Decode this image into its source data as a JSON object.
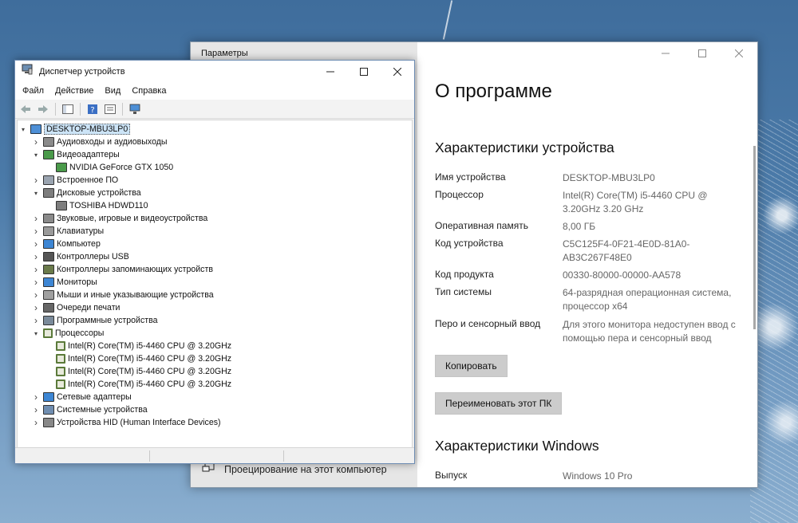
{
  "settings": {
    "window_title": "Параметры",
    "heading": "О программе",
    "device_specs_heading": "Характеристики устройства",
    "specs": [
      {
        "label": "Имя устройства",
        "value": "DESKTOP-MBU3LP0"
      },
      {
        "label": "Процессор",
        "value": "Intel(R) Core(TM) i5-4460  CPU @ 3.20GHz   3.20 GHz"
      },
      {
        "label": "Оперативная память",
        "value": "8,00 ГБ"
      },
      {
        "label": "Код устройства",
        "value": "C5C125F4-0F21-4E0D-81A0-AB3C267F48E0"
      },
      {
        "label": "Код продукта",
        "value": "00330-80000-00000-AA578"
      },
      {
        "label": "Тип системы",
        "value": "64-разрядная операционная система, процессор x64"
      },
      {
        "label": "Перо и сенсорный ввод",
        "value": "Для этого монитора недоступен ввод с помощью пера и сенсорный ввод"
      }
    ],
    "copy_button": "Копировать",
    "rename_button": "Переименовать этот ПК",
    "windows_specs_heading": "Характеристики Windows",
    "edition_label": "Выпуск",
    "edition_value": "Windows 10 Pro",
    "project_label": "Проецирование на этот компьютер"
  },
  "device_manager": {
    "window_title": "Диспетчер устройств",
    "menu": [
      "Файл",
      "Действие",
      "Вид",
      "Справка"
    ],
    "root": "DESKTOP-MBU3LP0",
    "tree": [
      {
        "label": "Аудиовходы и аудиовыходы",
        "level": 1,
        "expand": "collapsed",
        "icon": "speaker-icon"
      },
      {
        "label": "Видеоадаптеры",
        "level": 1,
        "expand": "expanded",
        "icon": "display-adapter-icon"
      },
      {
        "label": "NVIDIA GeForce GTX 1050",
        "level": 2,
        "expand": "none",
        "icon": "display-adapter-icon"
      },
      {
        "label": "Встроенное ПО",
        "level": 1,
        "expand": "collapsed",
        "icon": "firmware-icon"
      },
      {
        "label": "Дисковые устройства",
        "level": 1,
        "expand": "expanded",
        "icon": "disk-icon"
      },
      {
        "label": "TOSHIBA HDWD110",
        "level": 2,
        "expand": "none",
        "icon": "disk-icon"
      },
      {
        "label": "Звуковые, игровые и видеоустройства",
        "level": 1,
        "expand": "collapsed",
        "icon": "speaker-icon"
      },
      {
        "label": "Клавиатуры",
        "level": 1,
        "expand": "collapsed",
        "icon": "keyboard-icon"
      },
      {
        "label": "Компьютер",
        "level": 1,
        "expand": "collapsed",
        "icon": "monitor-icon"
      },
      {
        "label": "Контроллеры USB",
        "level": 1,
        "expand": "collapsed",
        "icon": "usb-icon"
      },
      {
        "label": "Контроллеры запоминающих устройств",
        "level": 1,
        "expand": "collapsed",
        "icon": "storage-controller-icon"
      },
      {
        "label": "Мониторы",
        "level": 1,
        "expand": "collapsed",
        "icon": "monitor-icon"
      },
      {
        "label": "Мыши и иные указывающие устройства",
        "level": 1,
        "expand": "collapsed",
        "icon": "mouse-icon"
      },
      {
        "label": "Очереди печати",
        "level": 1,
        "expand": "collapsed",
        "icon": "printer-icon"
      },
      {
        "label": "Программные устройства",
        "level": 1,
        "expand": "collapsed",
        "icon": "software-device-icon"
      },
      {
        "label": "Процессоры",
        "level": 1,
        "expand": "expanded",
        "icon": "processor-icon"
      },
      {
        "label": "Intel(R) Core(TM) i5-4460  CPU @ 3.20GHz",
        "level": 2,
        "expand": "none",
        "icon": "processor-icon"
      },
      {
        "label": "Intel(R) Core(TM) i5-4460  CPU @ 3.20GHz",
        "level": 2,
        "expand": "none",
        "icon": "processor-icon"
      },
      {
        "label": "Intel(R) Core(TM) i5-4460  CPU @ 3.20GHz",
        "level": 2,
        "expand": "none",
        "icon": "processor-icon"
      },
      {
        "label": "Intel(R) Core(TM) i5-4460  CPU @ 3.20GHz",
        "level": 2,
        "expand": "none",
        "icon": "processor-icon"
      },
      {
        "label": "Сетевые адаптеры",
        "level": 1,
        "expand": "collapsed",
        "icon": "network-icon"
      },
      {
        "label": "Системные устройства",
        "level": 1,
        "expand": "collapsed",
        "icon": "system-device-icon"
      },
      {
        "label": "Устройства HID (Human Interface Devices)",
        "level": 1,
        "expand": "collapsed",
        "icon": "hid-icon"
      }
    ]
  },
  "colors": {
    "accent": "#0078d7",
    "selection": "#cce4f7",
    "settings_sidebar": "#e6e6e6"
  }
}
